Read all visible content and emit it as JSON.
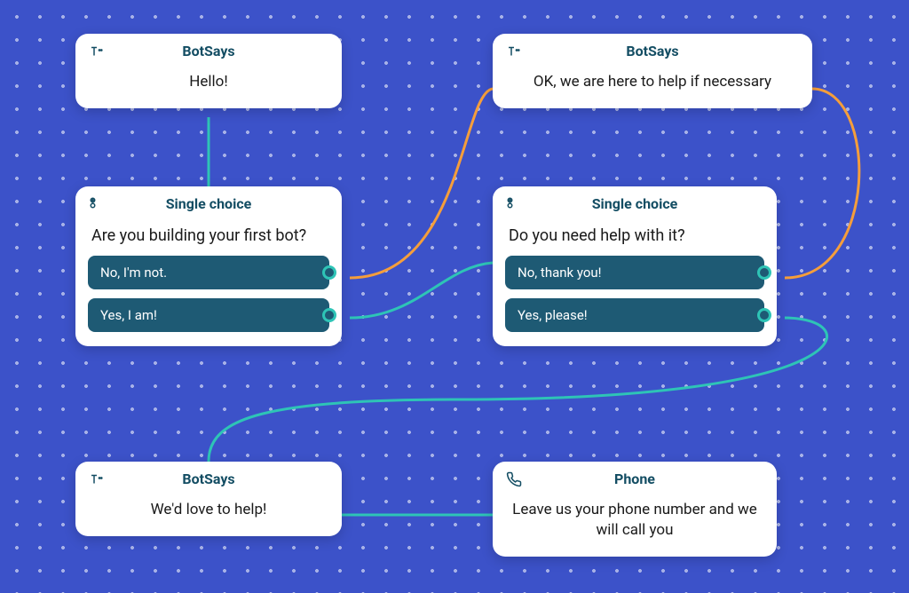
{
  "nodes": {
    "hello": {
      "type": "BotSays",
      "title": "BotSays",
      "text": "Hello!"
    },
    "firstbot": {
      "type": "SingleChoice",
      "title": "Single choice",
      "question": "Are you building your first bot?",
      "choices": [
        "No, I'm not.",
        "Yes, I am!"
      ]
    },
    "ok": {
      "type": "BotSays",
      "title": "BotSays",
      "text": "OK, we are here to help if necessary"
    },
    "needhelp": {
      "type": "SingleChoice",
      "title": "Single choice",
      "question": "Do you need help with it?",
      "choices": [
        "No, thank you!",
        "Yes, please!"
      ]
    },
    "lovehelp": {
      "type": "BotSays",
      "title": "BotSays",
      "text": "We'd love to help!"
    },
    "phone": {
      "type": "Phone",
      "title": "Phone",
      "text": "Leave us your phone number and we will call you"
    }
  },
  "colors": {
    "bg": "#3c52c9",
    "card": "#ffffff",
    "heading": "#134d63",
    "choiceBg": "#1e5a74",
    "teal": "#2ec4b6",
    "orange": "#f59e3b"
  }
}
